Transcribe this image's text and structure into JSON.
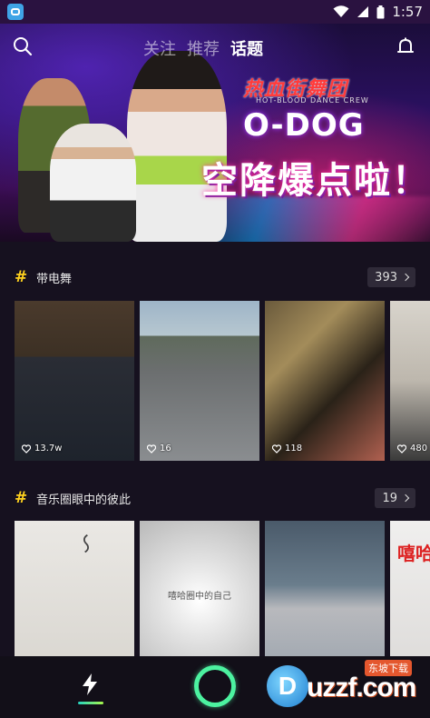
{
  "status_bar": {
    "time": "1:57"
  },
  "top_nav": {
    "tabs": [
      {
        "label": "关注",
        "active": false
      },
      {
        "label": "推荐",
        "active": false
      },
      {
        "label": "话题",
        "active": true
      }
    ]
  },
  "banner": {
    "logo_title": "热血街舞团",
    "logo_subtitle": "HOT-BLOOD DANCE CREW",
    "headline": "O-DOG",
    "sub_headline": "空降爆点啦！"
  },
  "topics": [
    {
      "name": "带电舞",
      "count": "393",
      "videos": [
        {
          "likes": "13.7w"
        },
        {
          "likes": "16"
        },
        {
          "likes": "118"
        },
        {
          "likes": "480"
        }
      ]
    },
    {
      "name": "音乐圈眼中的彼此",
      "count": "19",
      "videos": [
        {
          "overlay_text": ""
        },
        {
          "overlay_text": "嘻哈圈中的自己"
        },
        {
          "overlay_text": ""
        },
        {
          "overlay_text": "嘻哈"
        }
      ]
    }
  ],
  "watermark": {
    "text": "uzzf.com",
    "tag": "东坡下载",
    "logo_letter": "D"
  },
  "colors": {
    "accent_hash": "#ffd21e",
    "record_ring": "#4cf2a0",
    "background": "#16111f"
  }
}
